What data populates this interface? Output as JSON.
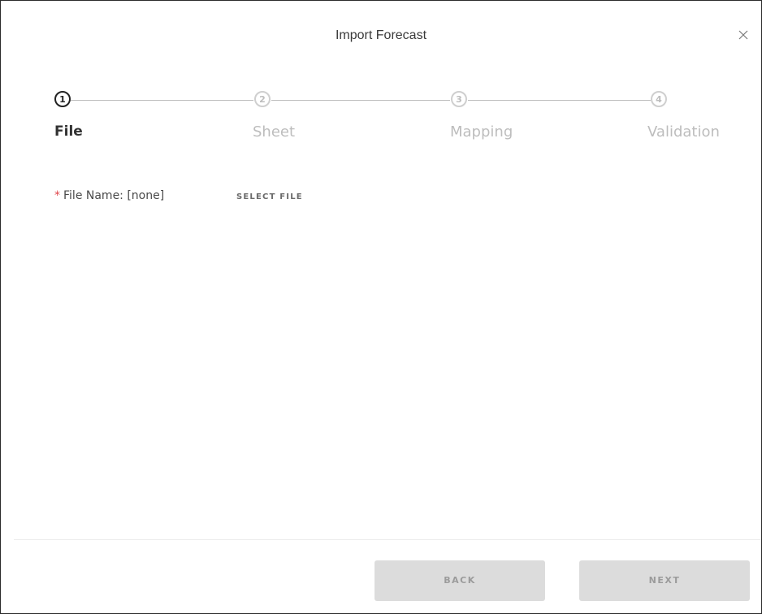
{
  "dialog": {
    "title": "Import Forecast",
    "close_icon": "close-icon"
  },
  "stepper": {
    "steps": [
      {
        "number": "1",
        "label": "File",
        "active": true
      },
      {
        "number": "2",
        "label": "Sheet",
        "active": false
      },
      {
        "number": "3",
        "label": "Mapping",
        "active": false
      },
      {
        "number": "4",
        "label": "Validation",
        "active": false
      }
    ]
  },
  "file": {
    "required_marker": "*",
    "label": "File Name: [none]",
    "select_label": "SELECT FILE"
  },
  "footer": {
    "back_label": "BACK",
    "next_label": "NEXT"
  },
  "colors": {
    "active": "#222222",
    "inactive": "#bdbdbd",
    "required": "#e0454a",
    "button_disabled_bg": "#dcdcdc",
    "button_disabled_text": "#9b9b9b"
  }
}
